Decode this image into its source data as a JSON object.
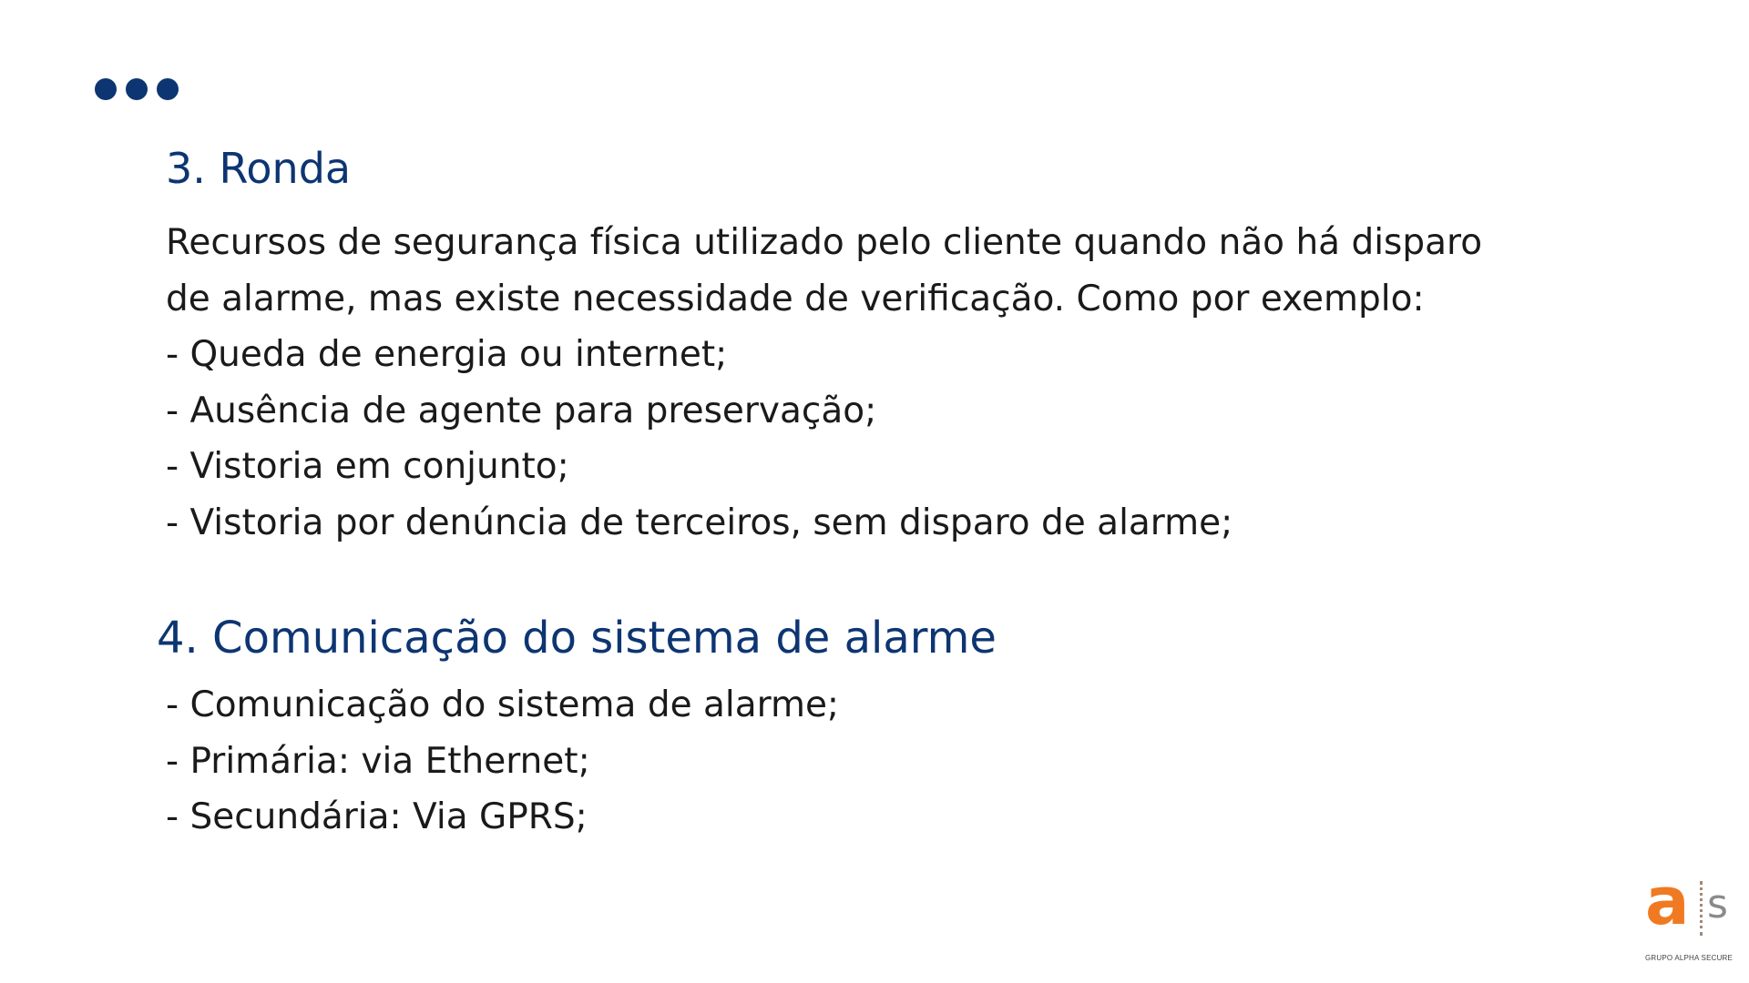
{
  "section_ronda": {
    "title": "3. Ronda",
    "lines": [
      "Recursos de segurança física utilizado pelo cliente quando não há disparo",
      "de alarme, mas existe necessidade de verificação. Como por exemplo:",
      "- Queda de energia ou internet;",
      "- Ausência de agente para preservação;",
      "- Vistoria em conjunto;",
      "- Vistoria por denúncia de terceiros, sem disparo de alarme;"
    ]
  },
  "section_comunicacao": {
    "title": "4. Comunicação do sistema de alarme",
    "lines": [
      "- Comunicação do sistema de alarme;",
      "- Primária: via Ethernet;",
      "- Secundária: Via GPRS;"
    ]
  },
  "logo": {
    "letter_a": "a",
    "letter_s": "s",
    "caption": "GRUPO ALPHA SECURE"
  },
  "colors": {
    "accent": "#0d3572",
    "logo_orange": "#f07a22",
    "logo_gray": "#8a8a8a",
    "text": "#1a1a1a"
  }
}
